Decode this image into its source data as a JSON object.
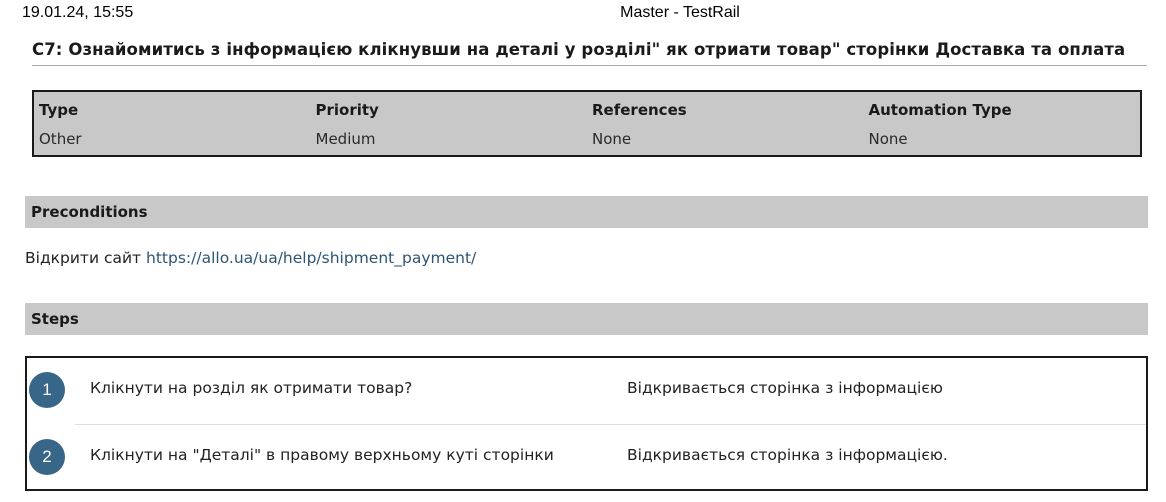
{
  "print_header": {
    "datetime": "19.01.24, 15:55",
    "title": "Master - TestRail"
  },
  "case": {
    "title": "C7: Ознайомитись з інформацією клікнувши на деталі у розділі\" як отриати товар\" сторінки Доставка та оплата"
  },
  "fields": [
    {
      "label": "Type",
      "value": "Other"
    },
    {
      "label": "Priority",
      "value": "Medium"
    },
    {
      "label": "References",
      "value": "None"
    },
    {
      "label": "Automation Type",
      "value": "None"
    }
  ],
  "preconditions": {
    "heading": "Preconditions",
    "text": "Відкрити сайт",
    "link": "https://allo.ua/ua/help/shipment_payment/"
  },
  "steps": {
    "heading": "Steps",
    "items": [
      {
        "number": "1",
        "content": "Клікнути на розділ як отримати товар?",
        "expected": "Відкривається сторінка з інформацією"
      },
      {
        "number": "2",
        "content": "Клікнути на \"Деталі\" в правому верхньому куті сторінки",
        "expected": "Відкривається сторінка з інформацією."
      }
    ]
  }
}
